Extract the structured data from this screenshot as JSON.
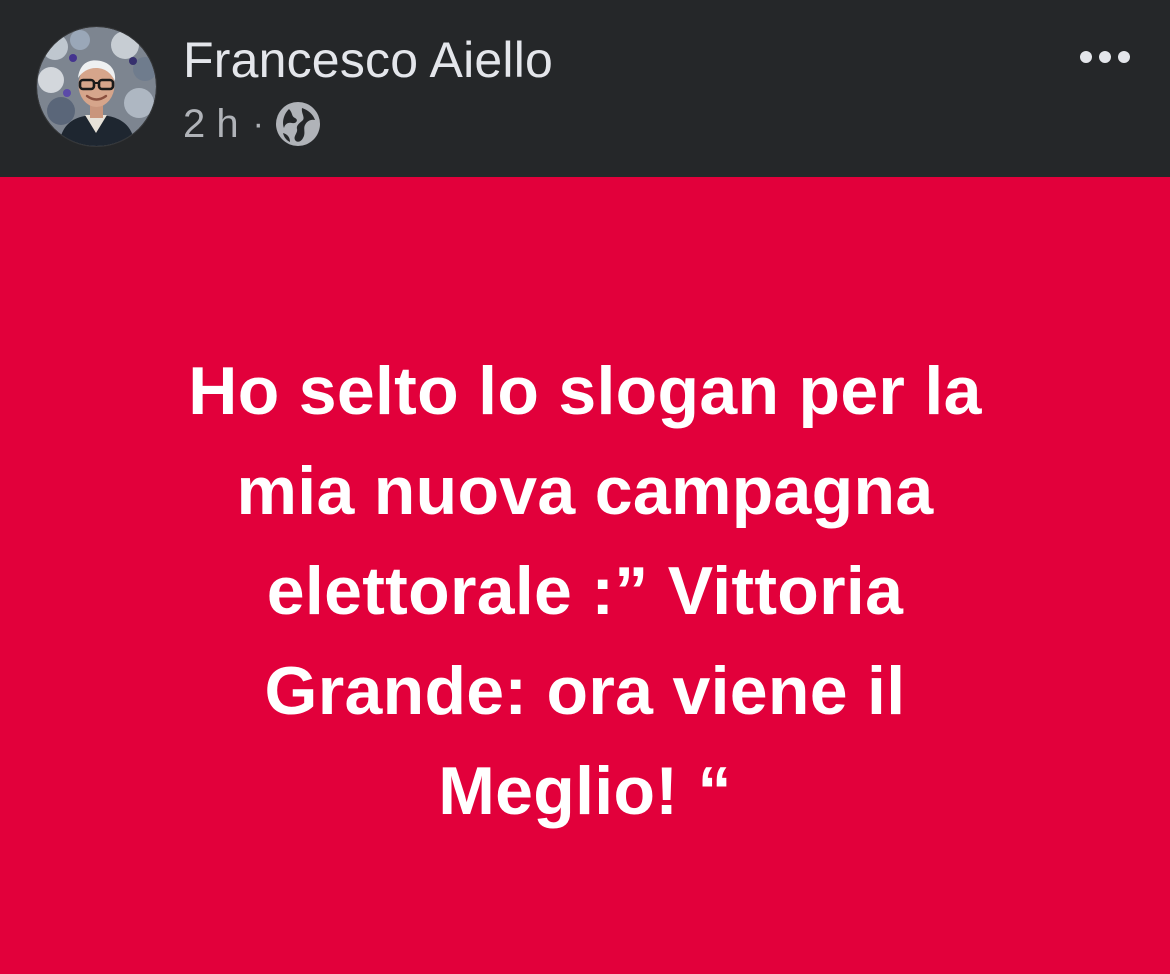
{
  "post": {
    "author_name": "Francesco Aiello",
    "timestamp": "2 h",
    "separator": "·",
    "audience_icon": "globe-icon",
    "more_icon": "more-horizontal-icon",
    "body_lines": [
      "Ho selto lo slogan per la",
      "mia nuova campagna",
      "elettorale :” Vittoria",
      "Grande: ora viene il",
      "Meglio! “"
    ]
  },
  "colors": {
    "header_background": "#252729",
    "post_background": "#e2003b",
    "author_text": "#e4e6eb",
    "meta_text": "#b0b3b8",
    "post_text": "#ffffff"
  }
}
